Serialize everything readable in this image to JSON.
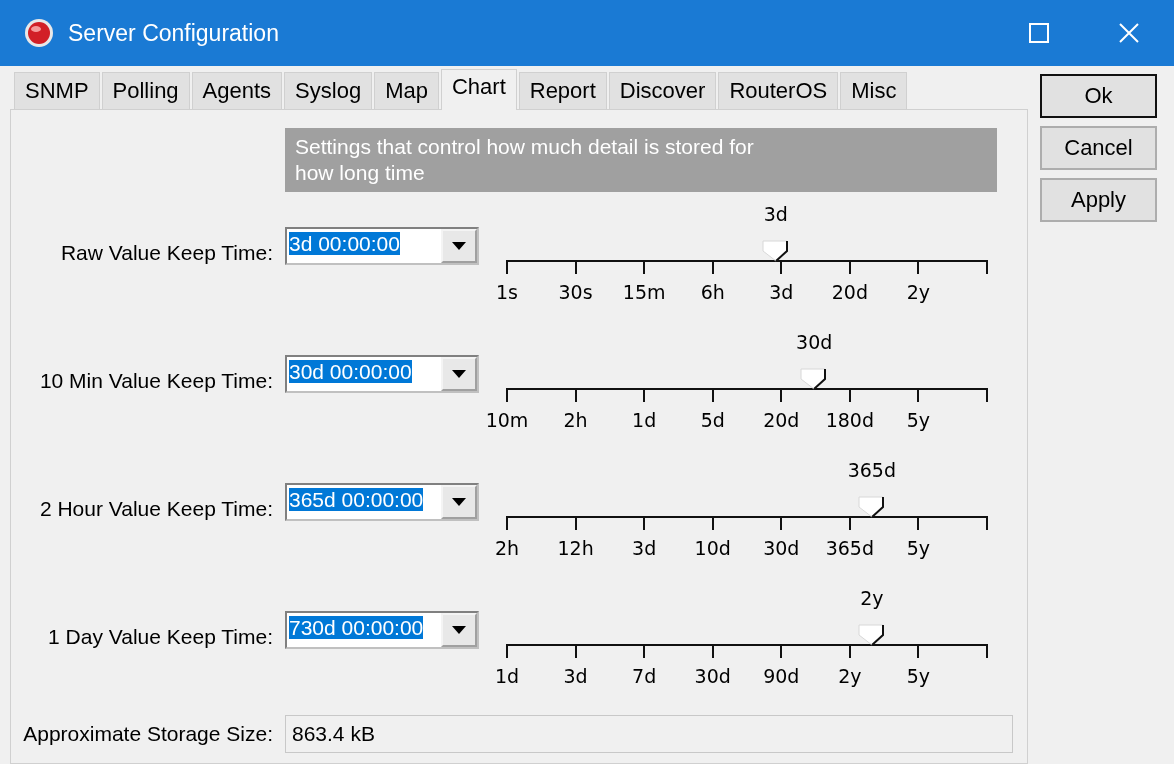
{
  "window": {
    "title": "Server Configuration"
  },
  "tabs": [
    {
      "label": "SNMP",
      "selected": false
    },
    {
      "label": "Polling",
      "selected": false
    },
    {
      "label": "Agents",
      "selected": false
    },
    {
      "label": "Syslog",
      "selected": false
    },
    {
      "label": "Map",
      "selected": false
    },
    {
      "label": "Chart",
      "selected": true
    },
    {
      "label": "Report",
      "selected": false
    },
    {
      "label": "Discover",
      "selected": false
    },
    {
      "label": "RouterOS",
      "selected": false
    },
    {
      "label": "Misc",
      "selected": false
    }
  ],
  "info": "Settings that control how much detail is stored for how long time",
  "rows": [
    {
      "label": "Raw Value Keep Time:",
      "value": "3d 00:00:00",
      "thumb_label": "3d",
      "level": 0.56,
      "ticks": [
        "1s",
        "30s",
        "15m",
        "6h",
        "3d",
        "20d",
        "2y"
      ]
    },
    {
      "label": "10 Min Value Keep Time:",
      "value": "30d 00:00:00",
      "thumb_label": "30d",
      "level": 0.64,
      "ticks": [
        "10m",
        "2h",
        "1d",
        "5d",
        "20d",
        "180d",
        "5y"
      ]
    },
    {
      "label": "2 Hour Value Keep Time:",
      "value": "365d 00:00:00",
      "thumb_label": "365d",
      "level": 0.76,
      "ticks": [
        "2h",
        "12h",
        "3d",
        "10d",
        "30d",
        "365d",
        "5y"
      ]
    },
    {
      "label": "1 Day Value Keep Time:",
      "value": "730d 00:00:00",
      "thumb_label": "2y",
      "level": 0.76,
      "ticks": [
        "1d",
        "3d",
        "7d",
        "30d",
        "90d",
        "2y",
        "5y"
      ]
    }
  ],
  "storage": {
    "label": "Approximate Storage Size:",
    "value": "863.4 kB"
  },
  "buttons": [
    {
      "label": "Ok",
      "default": true
    },
    {
      "label": "Cancel",
      "default": false
    },
    {
      "label": "Apply",
      "default": false
    }
  ]
}
